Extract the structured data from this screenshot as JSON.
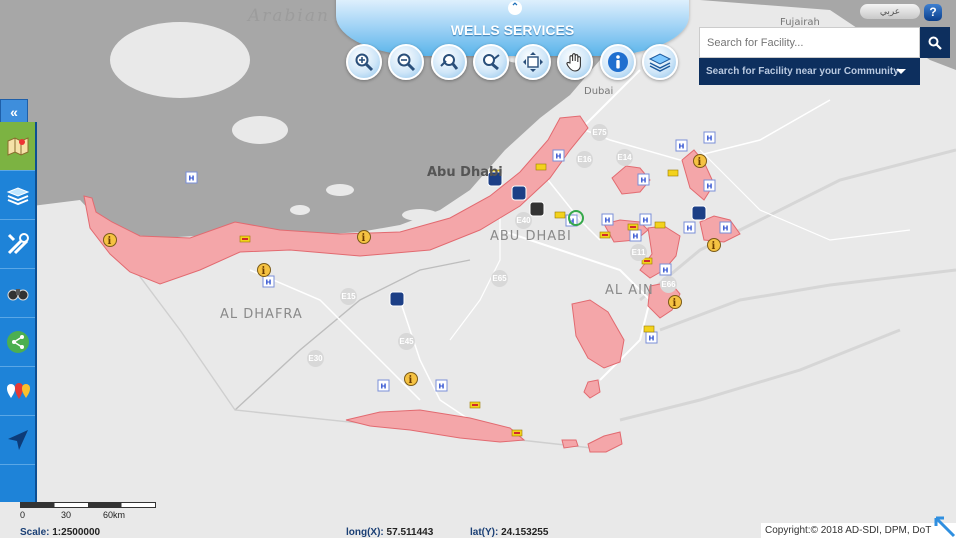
{
  "panel": {
    "title": "WELLS SERVICES",
    "collapse_glyph": "⌃",
    "tools": [
      {
        "name": "zoom-in",
        "icon": "zoom-in-icon"
      },
      {
        "name": "zoom-out",
        "icon": "zoom-out-icon"
      },
      {
        "name": "previous-extent",
        "icon": "zoom-previous-icon"
      },
      {
        "name": "next-extent",
        "icon": "zoom-next-icon"
      },
      {
        "name": "full-extent",
        "icon": "full-extent-icon"
      },
      {
        "name": "pan",
        "icon": "pan-hand-icon"
      },
      {
        "name": "identify",
        "icon": "info-icon"
      },
      {
        "name": "basemap",
        "icon": "basemap-icon"
      }
    ]
  },
  "header": {
    "language_label": "عربي",
    "help_label": "?"
  },
  "search": {
    "placeholder": "Search for Facility...",
    "community_label": "Search for Facility near your Community"
  },
  "sidebar": {
    "toggle_glyph": "«",
    "items": [
      {
        "name": "layers",
        "icon": "map-layers-icon",
        "active": true
      },
      {
        "name": "basemap-gallery",
        "icon": "basemap-gallery-icon"
      },
      {
        "name": "tools",
        "icon": "tools-icon"
      },
      {
        "name": "measure",
        "icon": "binoculars-icon"
      },
      {
        "name": "share",
        "icon": "share-icon"
      },
      {
        "name": "locations",
        "icon": "location-pins-icon"
      },
      {
        "name": "navigate",
        "icon": "navigation-arrow-icon"
      }
    ]
  },
  "map_labels": {
    "sea": "Arabian",
    "fujairah": "Fujairah",
    "dubai": "Dubai",
    "abu_dhabi_city": "Abu Dhabi",
    "abu_dhabi_region": "ABU DHABI",
    "al_ain": "AL AIN",
    "al_dhafra": "AL DHAFRA",
    "roads": [
      "E75",
      "E16",
      "E14",
      "E11",
      "E65",
      "E15",
      "E45",
      "E30",
      "E40",
      "E66"
    ]
  },
  "scale": {
    "ticks": [
      "0",
      "30",
      "60km"
    ],
    "label": "Scale:",
    "value": "1:2500000"
  },
  "coords": {
    "long_label": "long(X):",
    "long_value": "57.511443",
    "lat_label": "lat(Y):",
    "lat_value": "24.153255"
  },
  "copyright": "Copyright:© 2018 AD-SDI, DPM, DoT",
  "colors": {
    "zone_fill": "#f4a6a9",
    "zone_stroke": "#e26a70",
    "sidebar": "#1e83d8",
    "active": "#7cb342",
    "search_button": "#0d2f5e"
  }
}
